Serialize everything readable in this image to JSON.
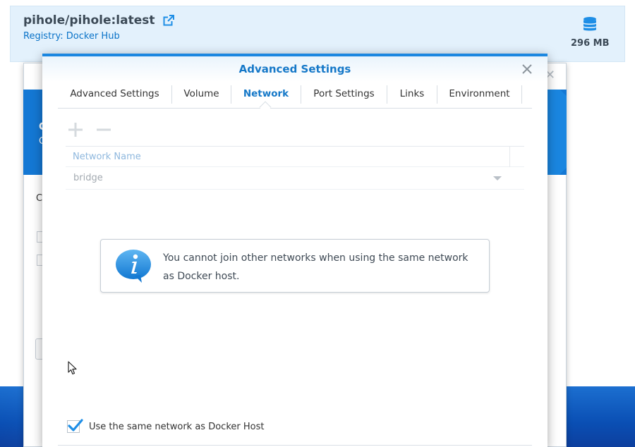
{
  "image": {
    "name": "pihole/pihole:latest",
    "registry": "Registry: Docker Hub",
    "size": "296 MB",
    "external_link_icon": "external-link-icon",
    "database_icon": "database-icon"
  },
  "dialog": {
    "title": "Advanced Settings",
    "close_icon": "close-icon",
    "tabs": [
      {
        "label": "Advanced Settings",
        "active": false
      },
      {
        "label": "Volume",
        "active": false
      },
      {
        "label": "Network",
        "active": true
      },
      {
        "label": "Port Settings",
        "active": false
      },
      {
        "label": "Links",
        "active": false
      },
      {
        "label": "Environment",
        "active": false
      }
    ],
    "toolbar": {
      "add_icon": "plus-icon",
      "remove_icon": "minus-icon"
    },
    "network_table": {
      "header": "Network Name",
      "rows": [
        {
          "value": "bridge"
        }
      ]
    },
    "info": {
      "icon": "info-icon",
      "message": "You cannot join other networks when using the same network as Docker host."
    },
    "checkbox": {
      "label": "Use the same network as Docker Host",
      "checked": true
    }
  },
  "colors": {
    "accent": "#1578c8",
    "info_blue": "#1e8ee6",
    "desktop": "#0a4fb4"
  }
}
